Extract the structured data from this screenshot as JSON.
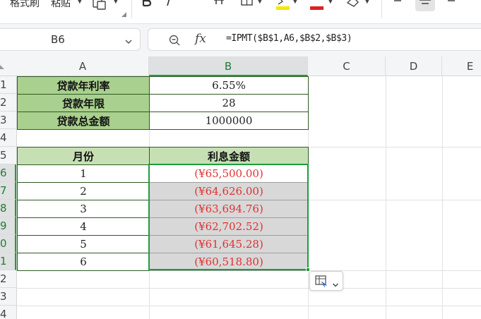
{
  "ribbon": {
    "format_painter_label": "格式刷",
    "paste_label": "粘贴"
  },
  "formula_bar": {
    "name_box": "B6",
    "fx_label": "fx",
    "formula": "=IPMT($B$1,A6,$B$2,$B$3)"
  },
  "columns": [
    "A",
    "B",
    "C",
    "D",
    "E"
  ],
  "rows": [
    "1",
    "2",
    "3",
    "4",
    "5",
    "6",
    "7",
    "8",
    "9",
    "0",
    "1",
    "2",
    "3",
    "4"
  ],
  "active_cell": "B6",
  "params": [
    {
      "label": "贷款年利率",
      "value": "6.55%"
    },
    {
      "label": "贷款年限",
      "value": "28"
    },
    {
      "label": "贷款总金额",
      "value": "1000000"
    }
  ],
  "table": {
    "headers": [
      "月份",
      "利息金额"
    ],
    "rows": [
      {
        "month": "1",
        "interest": "(¥65,500.00)"
      },
      {
        "month": "2",
        "interest": "(¥64,626.00)"
      },
      {
        "month": "3",
        "interest": "(¥63,694.76)"
      },
      {
        "month": "4",
        "interest": "(¥62,702.52)"
      },
      {
        "month": "5",
        "interest": "(¥61,645.28)"
      },
      {
        "month": "6",
        "interest": "(¥60,518.80)"
      }
    ]
  },
  "colors": {
    "label_fill": "#a9d08e",
    "header_fill": "#c6e0b4",
    "negative_text": "#e03131",
    "selection": "#1e9e3e"
  },
  "icons": [
    "format-painter-icon",
    "paste-icon",
    "bold-icon",
    "italic-icon",
    "strikethrough-icon",
    "borders-icon",
    "fill-color-icon",
    "font-color-icon",
    "clear-format-icon",
    "align-left-icon",
    "align-center-icon",
    "align-right-icon",
    "zoom-icon",
    "chevron-down-icon",
    "quick-analysis-icon"
  ]
}
